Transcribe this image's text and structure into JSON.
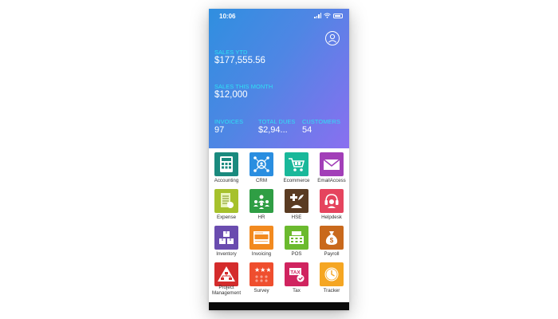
{
  "status": {
    "time": "10:06"
  },
  "stats": {
    "sales_ytd_label": "SALES YTD",
    "sales_ytd_value": "$177,555.56",
    "sales_month_label": "SALES THIS MONTH",
    "sales_month_value": "$12,000",
    "invoices_label": "INVOICES",
    "invoices_value": "97",
    "total_dues_label": "TOTAL DUES",
    "total_dues_value": "$2,94...",
    "customers_label": "CUSTOMERS",
    "customers_value": "54"
  },
  "apps": [
    {
      "label": "Accounting",
      "icon": "calculator-icon",
      "color": "#1a8a7e"
    },
    {
      "label": "CRM",
      "icon": "network-icon",
      "color": "#2a8ee0"
    },
    {
      "label": "Ecommerce",
      "icon": "cart-icon",
      "color": "#19b89a"
    },
    {
      "label": "EmailAccess",
      "icon": "envelope-icon",
      "color": "#a23fb8"
    },
    {
      "label": "Expense",
      "icon": "receipt-icon",
      "color": "#a6c12c"
    },
    {
      "label": "HR",
      "icon": "people-icon",
      "color": "#2f9e44"
    },
    {
      "label": "HSE",
      "icon": "safety-icon",
      "color": "#5a3b22"
    },
    {
      "label": "Helpdesk",
      "icon": "support-icon",
      "color": "#e5445e"
    },
    {
      "label": "Inventory",
      "icon": "boxes-icon",
      "color": "#6a4caf"
    },
    {
      "label": "Invoicing",
      "icon": "invoice-icon",
      "color": "#f28a1f"
    },
    {
      "label": "POS",
      "icon": "register-icon",
      "color": "#6bba2e"
    },
    {
      "label": "Payroll",
      "icon": "money-bag-icon",
      "color": "#c9691c"
    },
    {
      "label": "Project Management",
      "icon": "hierarchy-icon",
      "color": "#d42c2c"
    },
    {
      "label": "Survey",
      "icon": "stars-icon",
      "color": "#ef4e2e"
    },
    {
      "label": "Tax",
      "icon": "tax-icon",
      "color": "#d0245f"
    },
    {
      "label": "Tracker",
      "icon": "clock-icon",
      "color": "#f5a623"
    }
  ]
}
